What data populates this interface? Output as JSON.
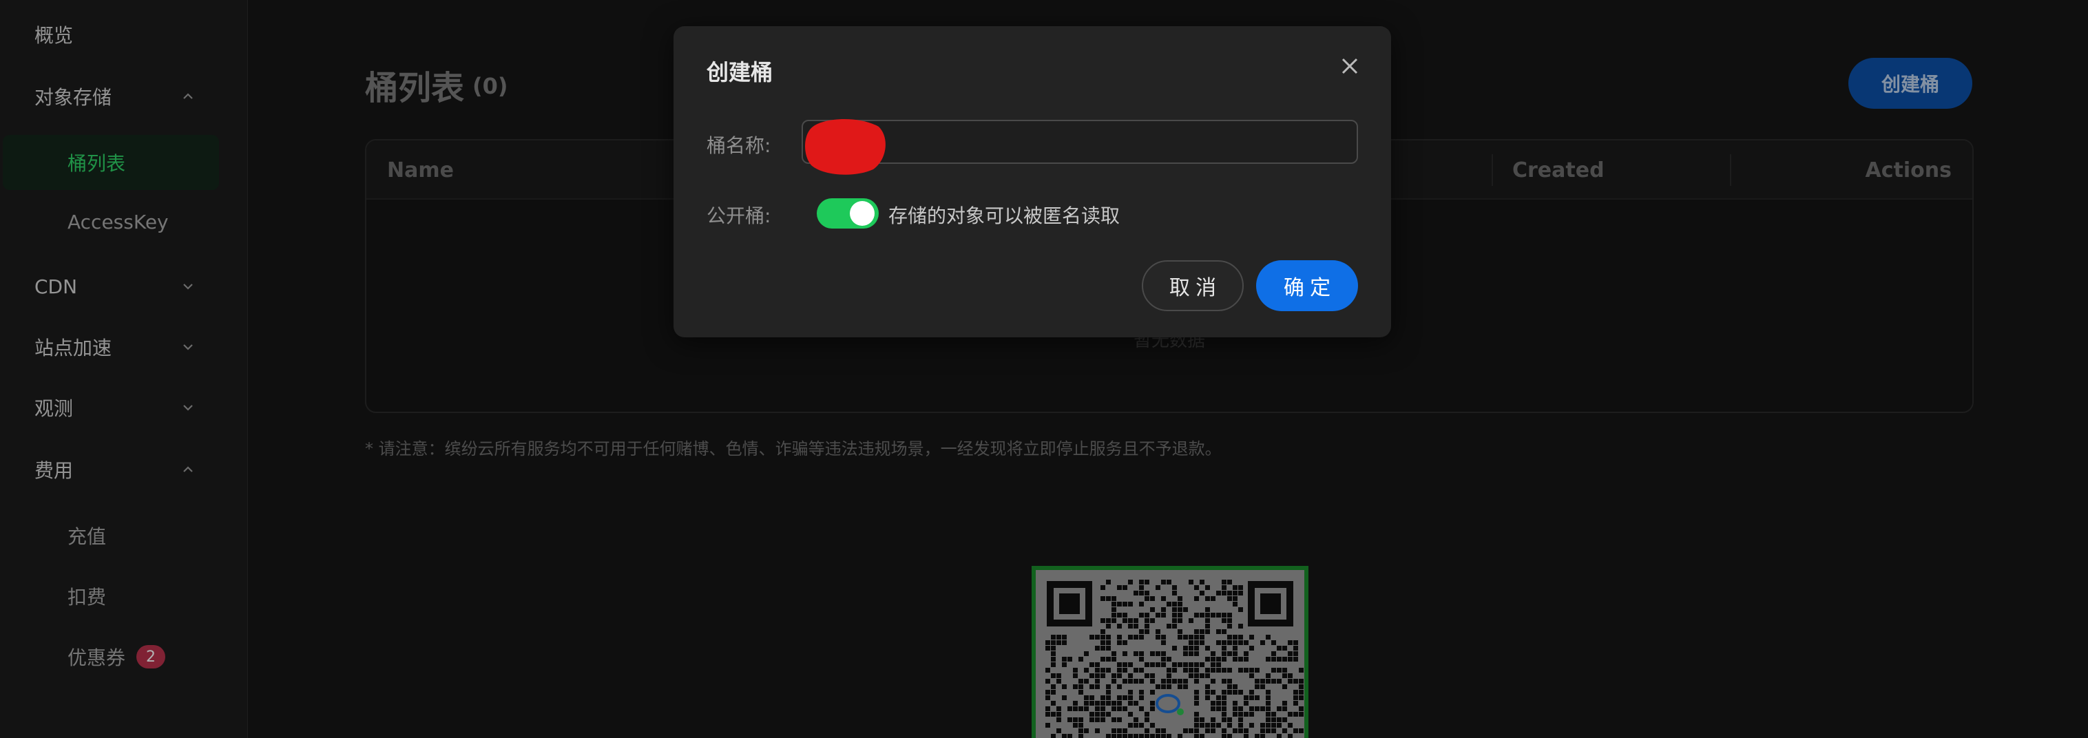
{
  "sidebar": {
    "items": [
      {
        "label": "概览"
      },
      {
        "label": "对象存储"
      },
      {
        "label": "桶列表"
      },
      {
        "label": "AccessKey"
      },
      {
        "label": "CDN"
      },
      {
        "label": "站点加速"
      },
      {
        "label": "观测"
      },
      {
        "label": "费用"
      },
      {
        "label": "充值"
      },
      {
        "label": "扣费"
      },
      {
        "label": "优惠券",
        "badge": "2"
      }
    ]
  },
  "main": {
    "title": "桶列表",
    "count": "(0)",
    "create_button": "创建桶",
    "table": {
      "columns": [
        "Name",
        "Created",
        "Actions"
      ],
      "empty_text": "暂无数据"
    },
    "notice": "* 请注意：缤纷云所有服务均不可用于任何赌博、色情、诈骗等违法违规场景，一经发现将立即停止服务且不予退款。"
  },
  "modal": {
    "title": "创建桶",
    "name_label": "桶名称:",
    "name_value": "",
    "public_label": "公开桶:",
    "public_enabled": true,
    "public_description": "存储的对象可以被匿名读取",
    "cancel_label": "取 消",
    "ok_label": "确 定"
  },
  "colors": {
    "accent_green": "#1ec95a",
    "primary_blue": "#0f6fe6",
    "badge_red": "#b8324b"
  }
}
